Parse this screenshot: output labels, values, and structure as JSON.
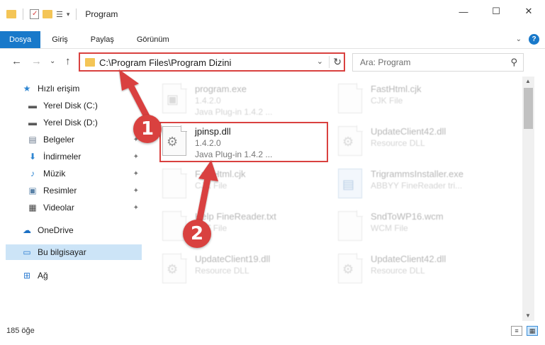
{
  "window": {
    "title": "Program",
    "min": "—",
    "max": "☐",
    "close": "✕"
  },
  "ribbon": {
    "tabs": [
      "Dosya",
      "Giriş",
      "Paylaş",
      "Görünüm"
    ],
    "expand": "⌄",
    "help": "?"
  },
  "nav": {
    "back": "←",
    "forward": "→",
    "recent": "⌄",
    "up": "↑",
    "address": "C:\\Program Files\\Program Dizini",
    "address_dropdown": "⌄",
    "refresh": "↻",
    "search_placeholder": "Ara: Program",
    "search_glyph": "⚲"
  },
  "sidebar": {
    "items": [
      {
        "label": "Hızlı erişim",
        "icon": "star-icon",
        "glyph": "★",
        "color": "#2f86d2"
      },
      {
        "label": "Yerel Disk (C:)",
        "icon": "drive-icon",
        "glyph": "▬",
        "color": "#5a5a5a"
      },
      {
        "label": "Yerel Disk (D:)",
        "icon": "drive-icon",
        "glyph": "▬",
        "color": "#5a5a5a"
      },
      {
        "label": "Belgeler",
        "icon": "document-icon",
        "glyph": "▤",
        "color": "#6b7a8c",
        "pin": "📌"
      },
      {
        "label": "İndirmeler",
        "icon": "download-icon",
        "glyph": "⬇",
        "color": "#2f86d2",
        "pin": "📌"
      },
      {
        "label": "Müzik",
        "icon": "music-icon",
        "glyph": "♪",
        "color": "#2f86d2",
        "pin": "📌"
      },
      {
        "label": "Resimler",
        "icon": "pictures-icon",
        "glyph": "▣",
        "color": "#5b83a8",
        "pin": "📌"
      },
      {
        "label": "Videolar",
        "icon": "video-icon",
        "glyph": "▦",
        "color": "#444",
        "pin": "📌"
      },
      {
        "label": "OneDrive",
        "icon": "cloud-icon",
        "glyph": "☁",
        "color": "#1a6fc4"
      },
      {
        "label": "Bu bilgisayar",
        "icon": "computer-icon",
        "glyph": "▭",
        "color": "#2b7bd1"
      },
      {
        "label": "Ağ",
        "icon": "network-icon",
        "glyph": "⊞",
        "color": "#2b7bd1"
      }
    ]
  },
  "files": [
    {
      "name": "program.exe",
      "line2": "1.4.2.0",
      "line3": "Java Plug-in 1.4.2 ...",
      "faded": true
    },
    {
      "name": "FastHtml.cjk",
      "line2": "CJK File",
      "line3": "",
      "faded": true
    },
    {
      "name": "jpinsp.dll",
      "line2": "1.4.2.0",
      "line3": "Java Plug-in 1.4.2 ...",
      "faded": false
    },
    {
      "name": "UpdateClient42.dll",
      "line2": "Resource DLL",
      "line3": "",
      "faded": true
    },
    {
      "name": "FastHtml.cjk",
      "line2": "CJK File",
      "line3": "",
      "faded": true
    },
    {
      "name": "TrigrammsInstaller.exe",
      "line2": "ABBYY FineReader tri...",
      "line3": "",
      "faded": true
    },
    {
      "name": "Help FineReader.txt",
      "line2": "TXT File",
      "line3": "",
      "faded": true
    },
    {
      "name": "SndToWP16.wcm",
      "line2": "WCM File",
      "line3": "",
      "faded": true
    },
    {
      "name": "UpdateClient19.dll",
      "line2": "Resource DLL",
      "line3": "",
      "faded": true
    },
    {
      "name": "UpdateClient42.dll",
      "line2": "Resource DLL",
      "line3": "",
      "faded": true
    }
  ],
  "scroll": {
    "up": "▲",
    "down": "▼"
  },
  "status": {
    "count": "185 öğe",
    "details_view": "≡",
    "icons_view": "▦"
  },
  "callouts": [
    {
      "number": "1"
    },
    {
      "number": "2"
    }
  ],
  "colors": {
    "accent": "#1979ca",
    "highlight": "#d9413f",
    "selected": "#cce4f7"
  }
}
